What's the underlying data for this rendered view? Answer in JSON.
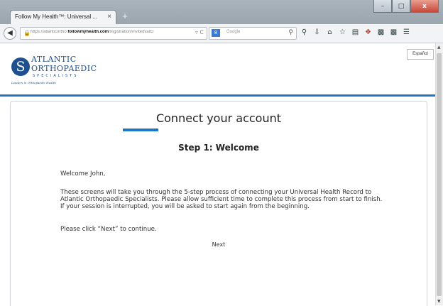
{
  "browser": {
    "tab_title": "Follow My Health™: Universal ...",
    "tab_close": "×",
    "new_tab": "+",
    "window_controls": [
      "–",
      "□",
      "x"
    ],
    "url_prefix": "https://atlanticortho.",
    "url_domain": "followmyhealth.com",
    "url_path": "/registration/invitedvalEl",
    "search_placeholder": "Google",
    "toolbar_icons": [
      "search-icon",
      "download-icon",
      "home-icon",
      "bookmark-star-icon",
      "bookmarks-list-icon",
      "extension-icon",
      "qr-icon",
      "qr-icon",
      "menu-icon"
    ]
  },
  "header": {
    "logo_line1": "ATLANTIC",
    "logo_line2": "ORTHOPAEDIC",
    "logo_line3": "SPECIALISTS",
    "logo_tagline": "Leaders in Orthopaedic Health",
    "logo_letter": "S",
    "language_button": "Español"
  },
  "main": {
    "title": "Connect your account",
    "step_title": "Step 1: Welcome",
    "greeting": "Welcome John,",
    "paragraph": "These screens will take you through the 5-step process of connecting your Universal Health Record to Atlantic Orthopaedic Specialists. Please allow sufficient time to complete this process from start to finish. If your session is interrupted, you will be asked to start again from the beginning.",
    "instruction": "Please click “Next” to continue.",
    "next_label": "Next"
  },
  "colors": {
    "accent": "#1f77c5",
    "brand": "#1e4f8f"
  }
}
